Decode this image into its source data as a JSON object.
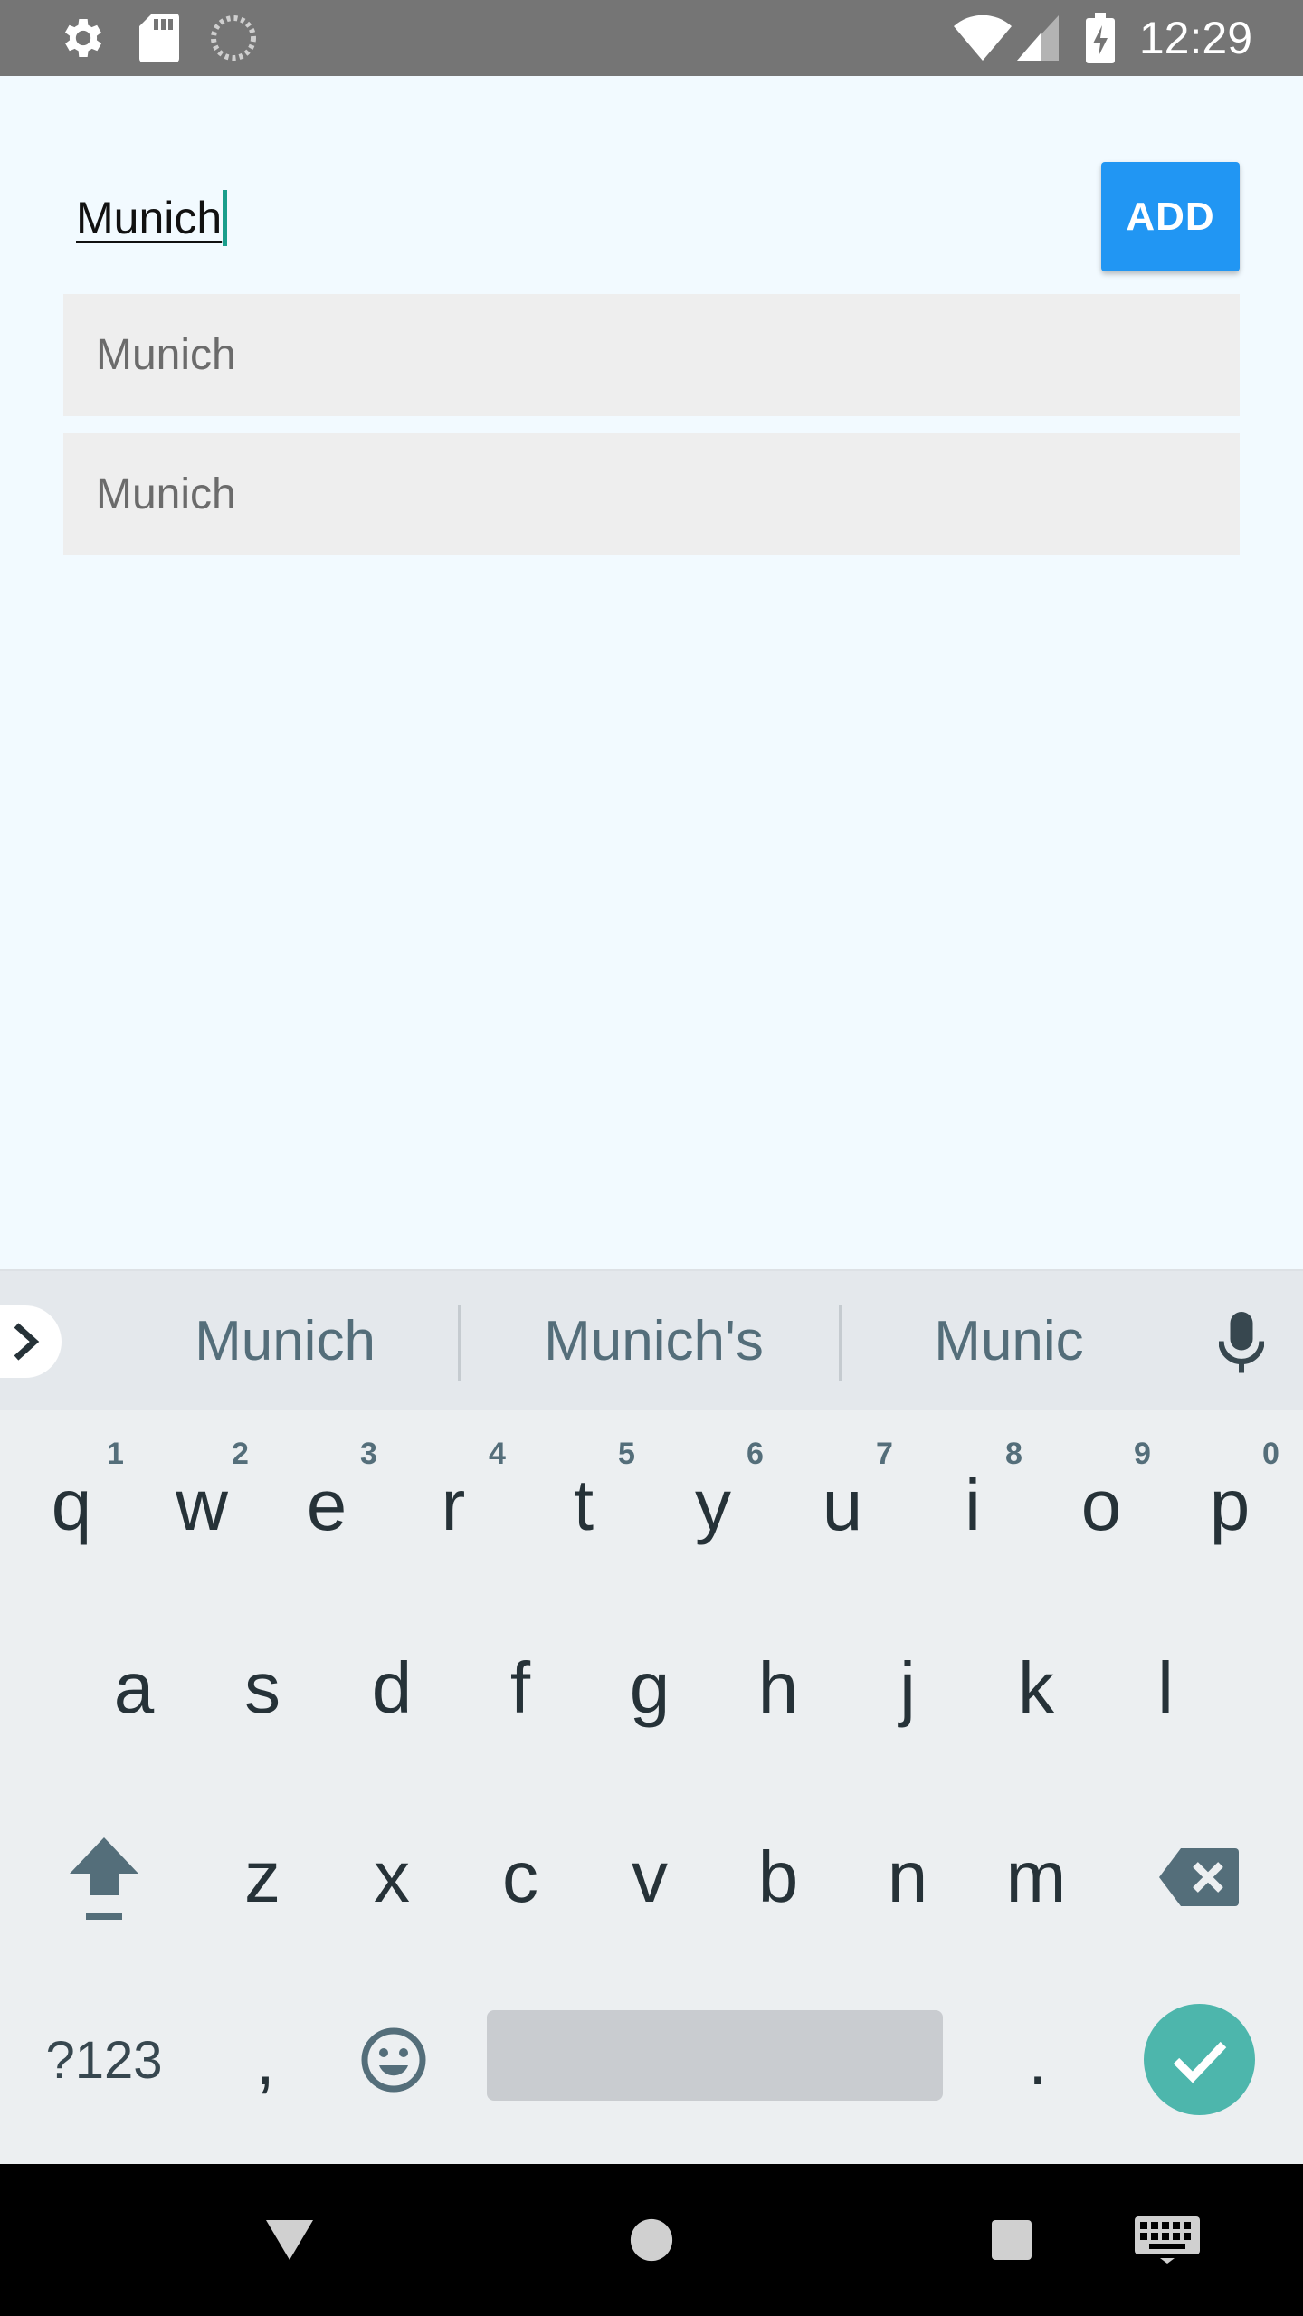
{
  "status_bar": {
    "time": "12:29",
    "left_icons": [
      "gear-icon",
      "sd-card-icon",
      "sync-icon"
    ],
    "right_icons": [
      "wifi-icon",
      "signal-icon",
      "battery-charging-icon"
    ]
  },
  "app": {
    "input": {
      "value": "Munich"
    },
    "add_button_label": "ADD",
    "list_items": [
      "Munich",
      "Munich"
    ]
  },
  "keyboard": {
    "suggestions": [
      "Munich",
      "Munich's",
      "Munic"
    ],
    "row1": [
      {
        "key": "q",
        "hint": "1"
      },
      {
        "key": "w",
        "hint": "2"
      },
      {
        "key": "e",
        "hint": "3"
      },
      {
        "key": "r",
        "hint": "4"
      },
      {
        "key": "t",
        "hint": "5"
      },
      {
        "key": "y",
        "hint": "6"
      },
      {
        "key": "u",
        "hint": "7"
      },
      {
        "key": "i",
        "hint": "8"
      },
      {
        "key": "o",
        "hint": "9"
      },
      {
        "key": "p",
        "hint": "0"
      }
    ],
    "row2": [
      "a",
      "s",
      "d",
      "f",
      "g",
      "h",
      "j",
      "k",
      "l"
    ],
    "row3": [
      "z",
      "x",
      "c",
      "v",
      "b",
      "n",
      "m"
    ],
    "symbols_label": "?123",
    "comma": ",",
    "period": "."
  },
  "colors": {
    "accent": "#2196f3",
    "caret": "#1a9e8c",
    "enter": "#4db6ac",
    "status_bar": "#757575",
    "background": "#f2faff"
  }
}
